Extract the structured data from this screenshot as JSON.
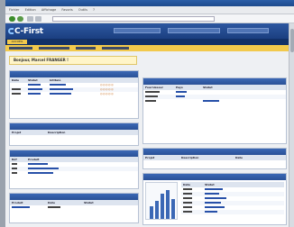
{
  "colors": {
    "brand_blue": "#1b3f80",
    "accent_yellow": "#f2c94c",
    "panel_header": "#2a5197"
  },
  "browser": {
    "menu": [
      "Fichier",
      "Edition",
      "Affichage",
      "Favoris",
      "Outils",
      "?"
    ]
  },
  "app": {
    "logo": "C-First",
    "tabs": [
      "ACCUEIL"
    ],
    "welcome": "Bonjour, Marcel FRANGER !"
  },
  "panels": {
    "left1": {
      "header_cols": [
        "Date",
        "Statut",
        "Intitulé",
        ""
      ],
      "rows": [
        [
          "",
          "",
          "",
          ""
        ],
        [
          "",
          "",
          "",
          ""
        ],
        [
          "",
          "",
          "",
          ""
        ]
      ]
    },
    "left2": {
      "header_cols": [
        "Projet",
        "Description"
      ]
    },
    "left3": {
      "header_cols": [
        "Réf",
        "Produit"
      ],
      "rows": [
        [
          "",
          ""
        ],
        [
          "",
          ""
        ],
        [
          "",
          ""
        ]
      ]
    },
    "left4": {
      "header_cols": [
        "Produit",
        "Date",
        "Statut"
      ]
    },
    "right1": {
      "header_cols": [
        "Fournisseur",
        "Pays",
        "Statut"
      ]
    },
    "right2": {
      "header_cols": [
        "Projet",
        "Description",
        "Date"
      ]
    },
    "right3": {
      "header_cols": [
        "Date",
        "Statut"
      ]
    }
  }
}
